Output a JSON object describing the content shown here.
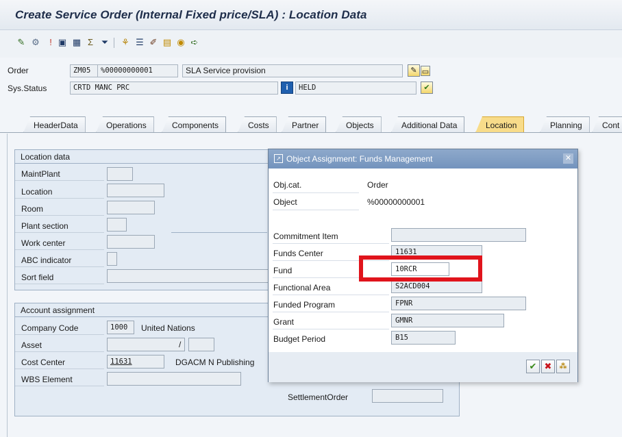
{
  "window": {
    "title": "Create Service Order (Internal Fixed price/SLA) : Location Data"
  },
  "toolbar": {
    "icons": [
      "pencil-check-icon",
      "gears-icon",
      "info-icon",
      "save-icon",
      "calculator-icon",
      "sum-icon",
      "filter-icon",
      "structure-icon",
      "list-icon",
      "edit-icon",
      "clipboard-icon",
      "alert-icon",
      "forward-icon"
    ]
  },
  "header": {
    "order_label": "Order",
    "order_type": "ZM05",
    "order_number": "%00000000001",
    "order_description": "SLA Service provision",
    "status_label": "Sys.Status",
    "system_status": "CRTD MANC PRC",
    "user_status": "HELD"
  },
  "tabs": [
    {
      "label": "HeaderData",
      "active": false
    },
    {
      "label": "Operations",
      "active": false
    },
    {
      "label": "Components",
      "active": false
    },
    {
      "label": "Costs",
      "active": false
    },
    {
      "label": "Partner",
      "active": false
    },
    {
      "label": "Objects",
      "active": false
    },
    {
      "label": "Additional Data",
      "active": false
    },
    {
      "label": "Location",
      "active": true
    },
    {
      "label": "Planning",
      "active": false
    },
    {
      "label": "Cont",
      "active": false
    }
  ],
  "location_data": {
    "title": "Location data",
    "fields": {
      "maintplant": "MaintPlant",
      "location": "Location",
      "room": "Room",
      "plant_section": "Plant section",
      "work_center": "Work center",
      "abc_indicator": "ABC indicator",
      "sort_field": "Sort field"
    }
  },
  "account_assignment": {
    "title": "Account assignment",
    "company_code_label": "Company Code",
    "company_code": "1000",
    "company_name": "United Nations",
    "asset_label": "Asset",
    "asset_sep": "/",
    "cost_center_label": "Cost Center",
    "cost_center": "11631",
    "cost_center_name": "DGACM N Publishing",
    "wbs_label": "WBS Element",
    "settlement_order_label": "SettlementOrder"
  },
  "dialog": {
    "title": "Object Assignment: Funds Management",
    "objcat_label": "Obj.cat.",
    "objcat_value": "Order",
    "object_label": "Object",
    "object_value": "%00000000001",
    "commitment_item_label": "Commitment Item",
    "commitment_item_value": "",
    "funds_center_label": "Funds Center",
    "funds_center_value": "11631",
    "fund_label": "Fund",
    "fund_value": "10RCR",
    "functional_area_label": "Functional Area",
    "functional_area_value": "S2ACD004",
    "funded_program_label": "Funded Program",
    "funded_program_value": "FPNR",
    "grant_label": "Grant",
    "grant_value": "GMNR",
    "budget_period_label": "Budget Period",
    "budget_period_value": "B15"
  },
  "colors": {
    "highlight": "#e0141c",
    "active_tab": "#f8dc8a",
    "dialog_header": "#7f9ec4"
  }
}
